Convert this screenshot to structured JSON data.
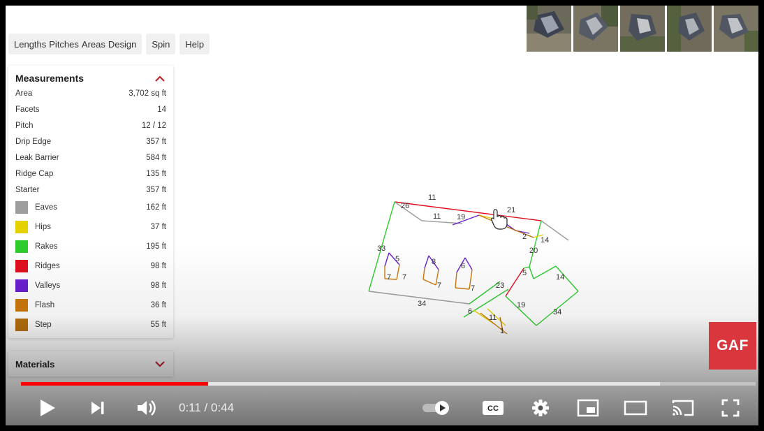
{
  "tabs": {
    "group1": [
      "Lengths",
      "Pitches",
      "Areas",
      "Design"
    ],
    "spin": "Spin",
    "help": "Help"
  },
  "measurements": {
    "title": "Measurements",
    "collapse_icon": "chevron-up-icon",
    "rows": [
      {
        "label": "Area",
        "value": "3,702 sq ft"
      },
      {
        "label": "Facets",
        "value": "14"
      },
      {
        "label": "Pitch",
        "value": "12 / 12"
      },
      {
        "label": "Drip Edge",
        "value": "357 ft"
      },
      {
        "label": "Leak Barrier",
        "value": "584 ft"
      },
      {
        "label": "Ridge Cap",
        "value": "135 ft"
      },
      {
        "label": "Starter",
        "value": "357 ft"
      }
    ],
    "colored_rows": [
      {
        "label": "Eaves",
        "value": "162 ft",
        "color": "#9e9e9e"
      },
      {
        "label": "Hips",
        "value": "37 ft",
        "color": "#e6d100"
      },
      {
        "label": "Rakes",
        "value": "195 ft",
        "color": "#2ecc2e"
      },
      {
        "label": "Ridges",
        "value": "98 ft",
        "color": "#e0101e"
      },
      {
        "label": "Valleys",
        "value": "98 ft",
        "color": "#6a1fd1"
      },
      {
        "label": "Flash",
        "value": "36 ft",
        "color": "#cc7a0a"
      },
      {
        "label": "Step",
        "value": "55 ft",
        "color": "#b8700d"
      }
    ]
  },
  "materials": {
    "label": "Materials",
    "expand_icon": "chevron-down-icon"
  },
  "diagram_labels": [
    "11",
    "26",
    "11",
    "19",
    "21",
    "2",
    "14",
    "33",
    "20",
    "5",
    "8",
    "6",
    "7",
    "7",
    "7",
    "7",
    "5",
    "14",
    "23",
    "34",
    "19",
    "34",
    "6",
    "11",
    "1"
  ],
  "logo": "GAF",
  "player": {
    "time": "0:11 / 0:44",
    "progress": 0.255,
    "buffered": 0.87,
    "accent": "#ff0000"
  },
  "icons": {
    "play": "play-icon",
    "next": "next-icon",
    "volume": "volume-icon",
    "autoplay": "autoplay-toggle-icon",
    "cc": "closed-captions-icon",
    "settings": "gear-icon",
    "miniplayer": "miniplayer-icon",
    "theater": "theater-mode-icon",
    "cast": "cast-icon",
    "fullscreen": "fullscreen-icon"
  }
}
